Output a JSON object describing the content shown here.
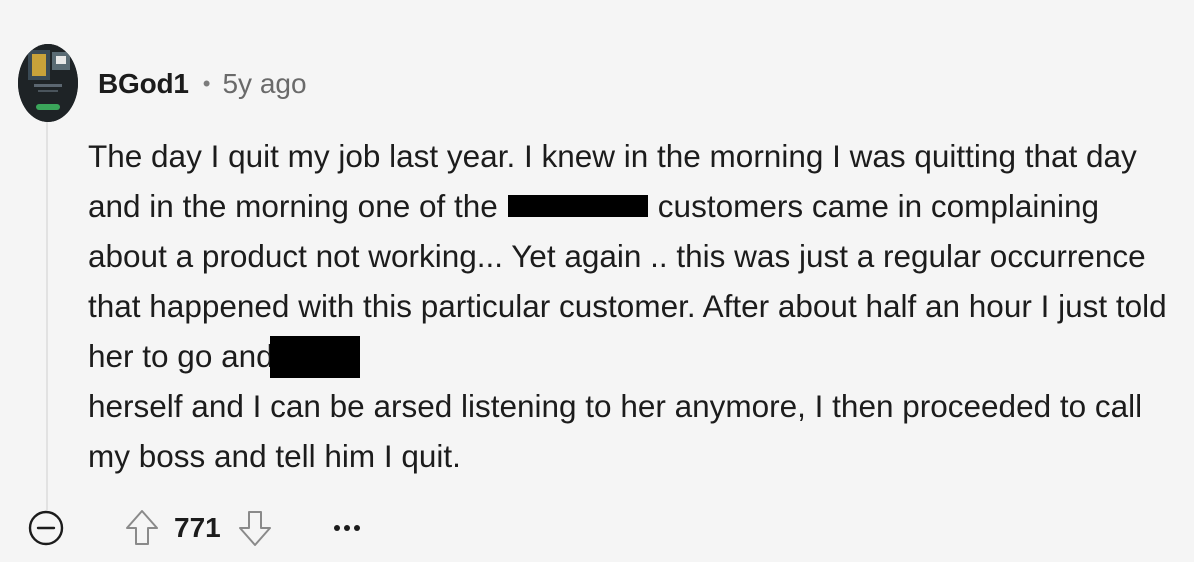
{
  "comment": {
    "author": "BGod1",
    "separator": "•",
    "age": "5y ago",
    "body": {
      "part1": "The day I quit my job last year. I knew in the morning I was quitting that day and in the morning one of the",
      "part2": "customers came in complaining about a product not working... Yet again .. this was just a regular occurrence that happened with this particular customer. After about half an hour I just told her to go and",
      "part3": "herself and I can be arsed listening to her anymore, I then proceeded to call my boss and tell him I quit."
    },
    "score": "771"
  },
  "icons": {
    "avatar": "user-avatar",
    "collapse": "minus-circle-icon",
    "upvote": "arrow-up-icon",
    "downvote": "arrow-down-icon",
    "more": "ellipsis-icon"
  },
  "colors": {
    "background": "#f5f5f5",
    "text": "#1c1c1c",
    "muted": "#6a6a6a",
    "thread_line": "#e2e2e2",
    "redaction": "#000000"
  }
}
